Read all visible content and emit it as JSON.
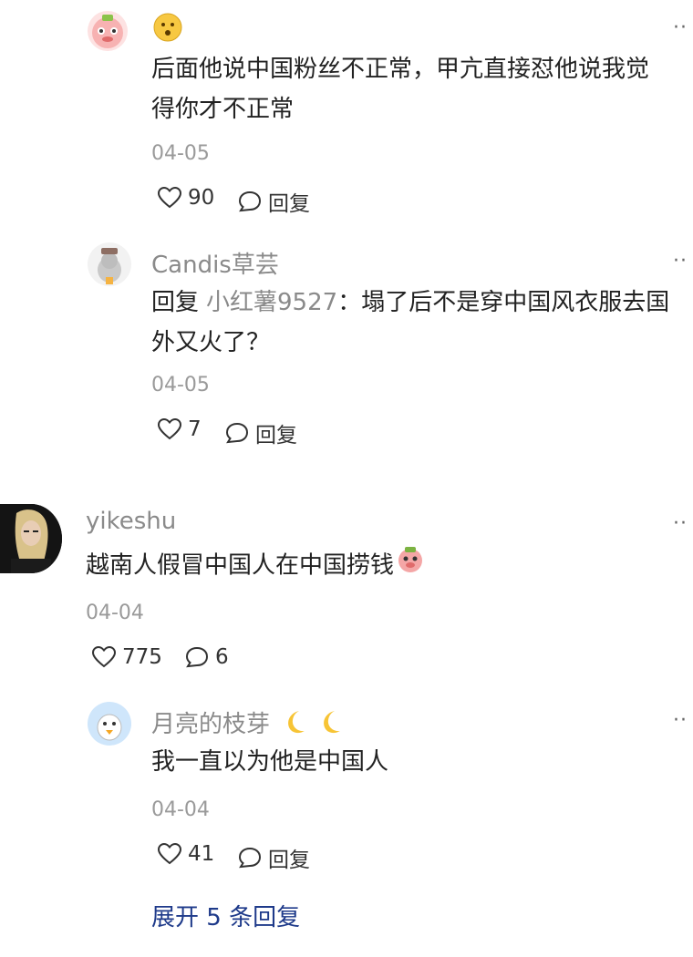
{
  "comments": [
    {
      "username": "",
      "text_line1": "后面他说中国粉丝不正常，甲亢直接怼他说我觉",
      "text_line2": "得你才不正常",
      "date": "04-05",
      "likes": "90",
      "reply_label": "回复"
    },
    {
      "username": "Candis草芸",
      "reply_prefix": "回复",
      "reply_to": "小红薯9527",
      "text_line1": "：塌了后不是穿中国风衣服去国",
      "text_line2": "外又火了？",
      "date": "04-05",
      "likes": "7",
      "reply_label": "回复"
    },
    {
      "username": "yikeshu",
      "text_line1": "越南人假冒中国人在中国捞钱",
      "date": "04-04",
      "likes": "775",
      "replies": "6"
    },
    {
      "username": "月亮的枝芽",
      "text_line1": "我一直以为他是中国人",
      "date": "04-04",
      "likes": "41",
      "reply_label": "回复"
    }
  ],
  "expand_label": "展开 5 条回复",
  "more_label": "··",
  "colors": {
    "link": "#1e3a8a",
    "muted": "#8a8a8a"
  }
}
